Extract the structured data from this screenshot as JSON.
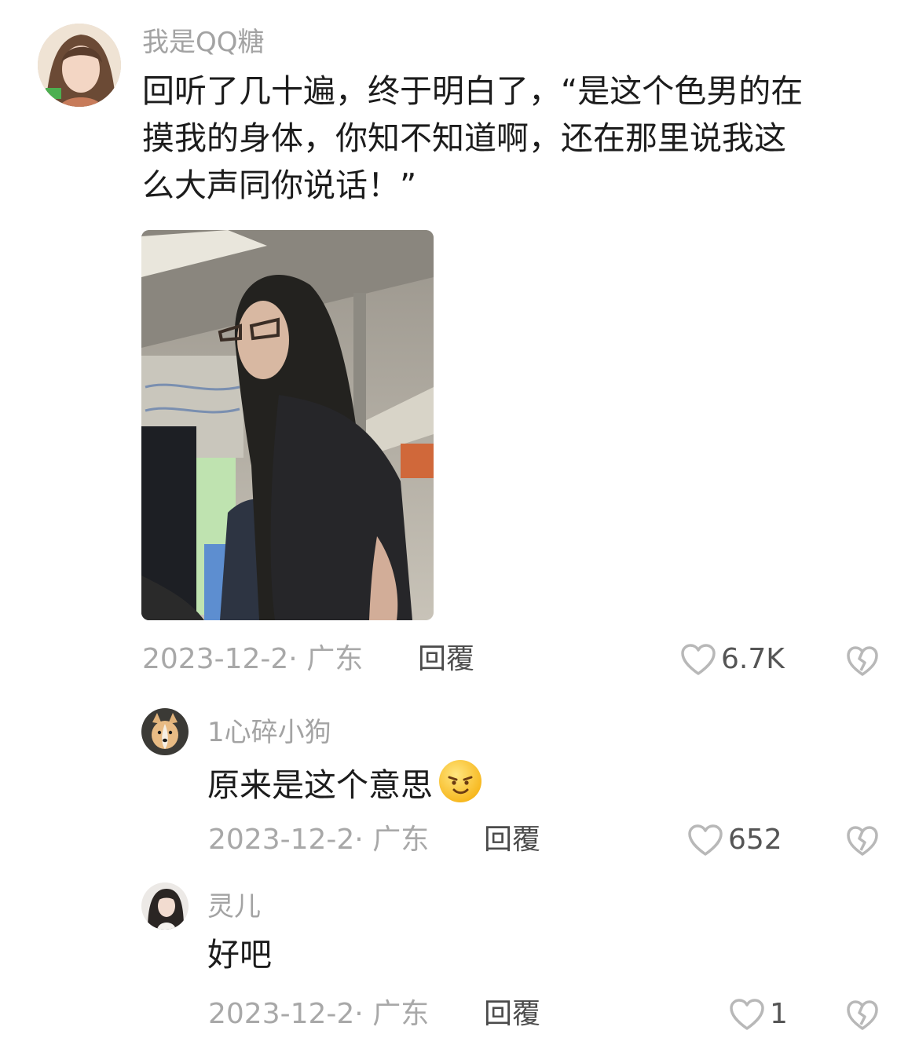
{
  "main_comment": {
    "username": "我是QQ糖",
    "lines": [
      "回听了几十遍，终于明白了，“是这个色男的在",
      "摸我的身体，你知不知道啊，还在那里说我这",
      "么大声同你说话！”"
    ],
    "meta": "2023-12-2· 广东",
    "reply_label": "回覆",
    "likes": "6.7K",
    "icons": {
      "like": "heart-outline-icon",
      "dislike": "broken-heart-icon",
      "photo": "subway-woman-photo"
    }
  },
  "replies": [
    {
      "username": "1心碎小狗",
      "text": "原来是这个意思",
      "emoji": "smug-face-emoji",
      "meta": "2023-12-2· 广东",
      "reply_label": "回覆",
      "likes": "652"
    },
    {
      "username": "灵儿",
      "text": "好吧",
      "meta": "2023-12-2· 广东",
      "reply_label": "回覆",
      "likes": "1"
    }
  ],
  "colors": {
    "muted": "#a8a8a8",
    "text": "#1c1c1c",
    "icon": "#b8b8b8"
  }
}
